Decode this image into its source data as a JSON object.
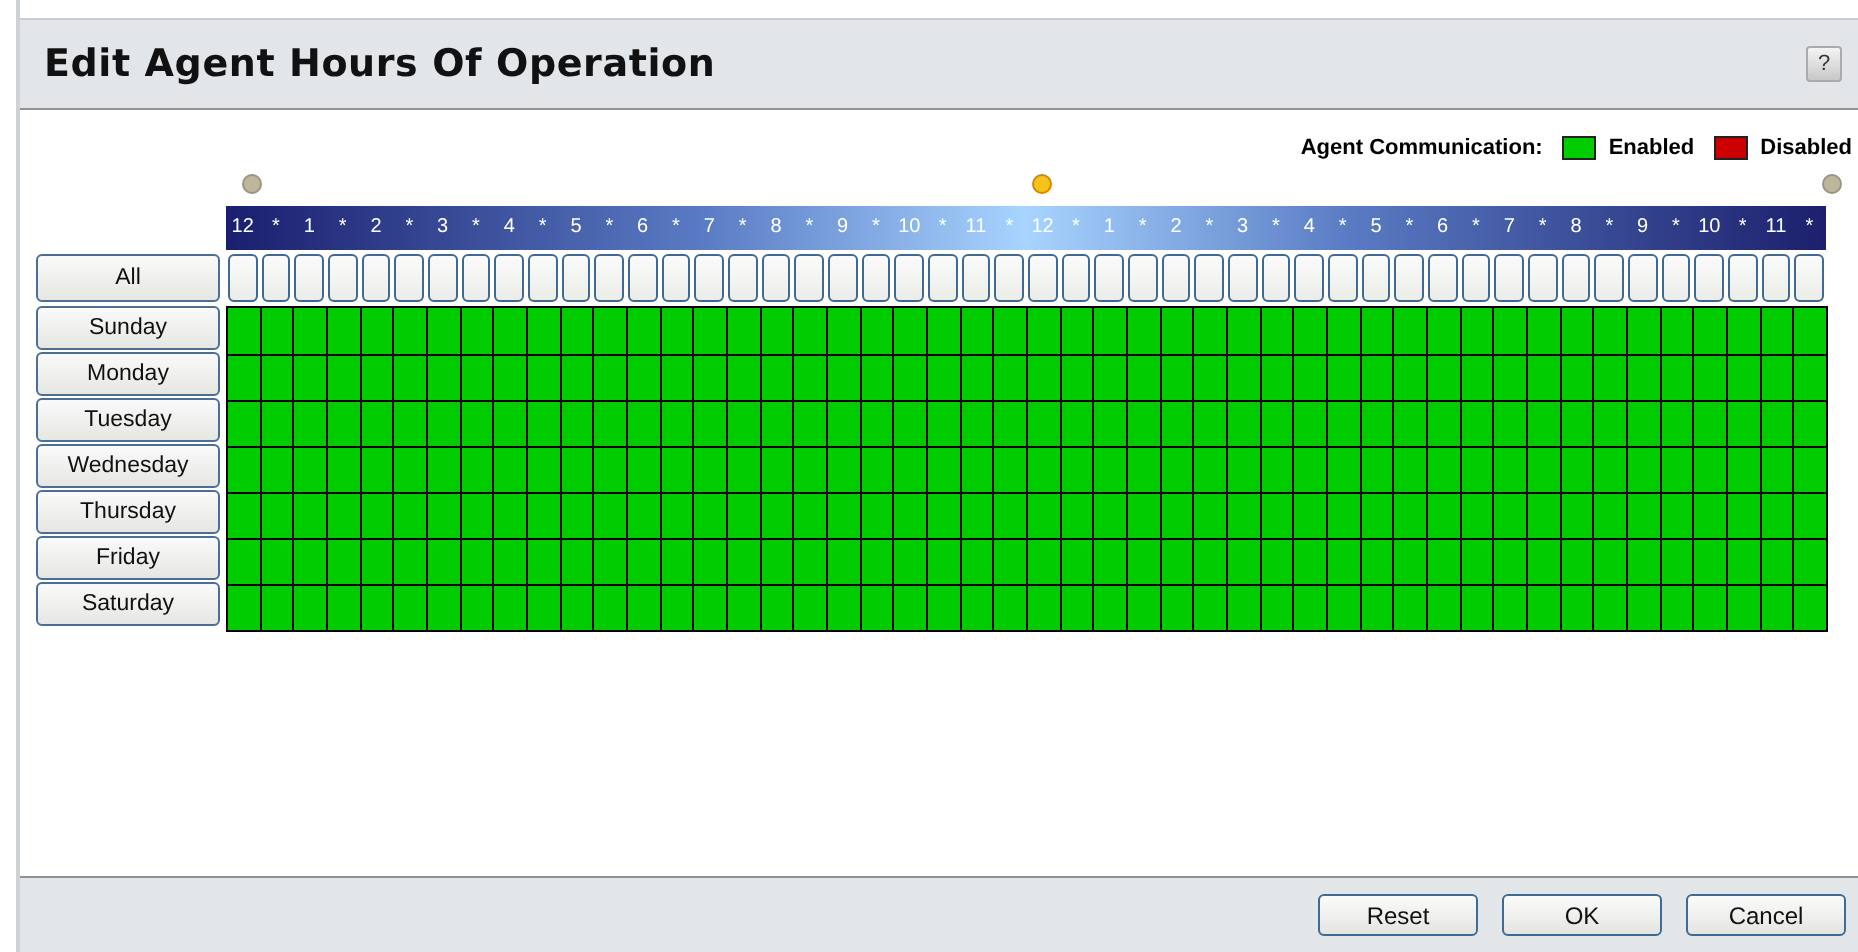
{
  "window": {
    "title": "Edit Agent Hours Of Operation",
    "help": "?"
  },
  "legend": {
    "label": "Agent Communication:",
    "items": [
      {
        "label": "Enabled",
        "color": "#00cc00"
      },
      {
        "label": "Disabled",
        "color": "#cc0000"
      }
    ]
  },
  "hours": [
    "12",
    "*",
    "1",
    "*",
    "2",
    "*",
    "3",
    "*",
    "4",
    "*",
    "5",
    "*",
    "6",
    "*",
    "7",
    "*",
    "8",
    "*",
    "9",
    "*",
    "10",
    "*",
    "11",
    "*",
    "12",
    "*",
    "1",
    "*",
    "2",
    "*",
    "3",
    "*",
    "4",
    "*",
    "5",
    "*",
    "6",
    "*",
    "7",
    "*",
    "8",
    "*",
    "9",
    "*",
    "10",
    "*",
    "11",
    "*"
  ],
  "all_button": "All",
  "days": [
    {
      "label": "Sunday",
      "enabled": [
        true,
        true,
        true,
        true,
        true,
        true,
        true,
        true,
        true,
        true,
        true,
        true,
        true,
        true,
        true,
        true,
        true,
        true,
        true,
        true,
        true,
        true,
        true,
        true,
        true,
        true,
        true,
        true,
        true,
        true,
        true,
        true,
        true,
        true,
        true,
        true,
        true,
        true,
        true,
        true,
        true,
        true,
        true,
        true,
        true,
        true,
        true,
        true
      ]
    },
    {
      "label": "Monday",
      "enabled": [
        true,
        true,
        true,
        true,
        true,
        true,
        true,
        true,
        true,
        true,
        true,
        true,
        true,
        true,
        true,
        true,
        true,
        true,
        true,
        true,
        true,
        true,
        true,
        true,
        true,
        true,
        true,
        true,
        true,
        true,
        true,
        true,
        true,
        true,
        true,
        true,
        true,
        true,
        true,
        true,
        true,
        true,
        true,
        true,
        true,
        true,
        true,
        true
      ]
    },
    {
      "label": "Tuesday",
      "enabled": [
        true,
        true,
        true,
        true,
        true,
        true,
        true,
        true,
        true,
        true,
        true,
        true,
        true,
        true,
        true,
        true,
        true,
        true,
        true,
        true,
        true,
        true,
        true,
        true,
        true,
        true,
        true,
        true,
        true,
        true,
        true,
        true,
        true,
        true,
        true,
        true,
        true,
        true,
        true,
        true,
        true,
        true,
        true,
        true,
        true,
        true,
        true,
        true
      ]
    },
    {
      "label": "Wednesday",
      "enabled": [
        true,
        true,
        true,
        true,
        true,
        true,
        true,
        true,
        true,
        true,
        true,
        true,
        true,
        true,
        true,
        true,
        true,
        true,
        true,
        true,
        true,
        true,
        true,
        true,
        true,
        true,
        true,
        true,
        true,
        true,
        true,
        true,
        true,
        true,
        true,
        true,
        true,
        true,
        true,
        true,
        true,
        true,
        true,
        true,
        true,
        true,
        true,
        true
      ]
    },
    {
      "label": "Thursday",
      "enabled": [
        true,
        true,
        true,
        true,
        true,
        true,
        true,
        true,
        true,
        true,
        true,
        true,
        true,
        true,
        true,
        true,
        true,
        true,
        true,
        true,
        true,
        true,
        true,
        true,
        true,
        true,
        true,
        true,
        true,
        true,
        true,
        true,
        true,
        true,
        true,
        true,
        true,
        true,
        true,
        true,
        true,
        true,
        true,
        true,
        true,
        true,
        true,
        true
      ]
    },
    {
      "label": "Friday",
      "enabled": [
        true,
        true,
        true,
        true,
        true,
        true,
        true,
        true,
        true,
        true,
        true,
        true,
        true,
        true,
        true,
        true,
        true,
        true,
        true,
        true,
        true,
        true,
        true,
        true,
        true,
        true,
        true,
        true,
        true,
        true,
        true,
        true,
        true,
        true,
        true,
        true,
        true,
        true,
        true,
        true,
        true,
        true,
        true,
        true,
        true,
        true,
        true,
        true
      ]
    },
    {
      "label": "Saturday",
      "enabled": [
        true,
        true,
        true,
        true,
        true,
        true,
        true,
        true,
        true,
        true,
        true,
        true,
        true,
        true,
        true,
        true,
        true,
        true,
        true,
        true,
        true,
        true,
        true,
        true,
        true,
        true,
        true,
        true,
        true,
        true,
        true,
        true,
        true,
        true,
        true,
        true,
        true,
        true,
        true,
        true,
        true,
        true,
        true,
        true,
        true,
        true,
        true,
        true
      ]
    }
  ],
  "buttons": [
    "Reset",
    "OK",
    "Cancel"
  ]
}
